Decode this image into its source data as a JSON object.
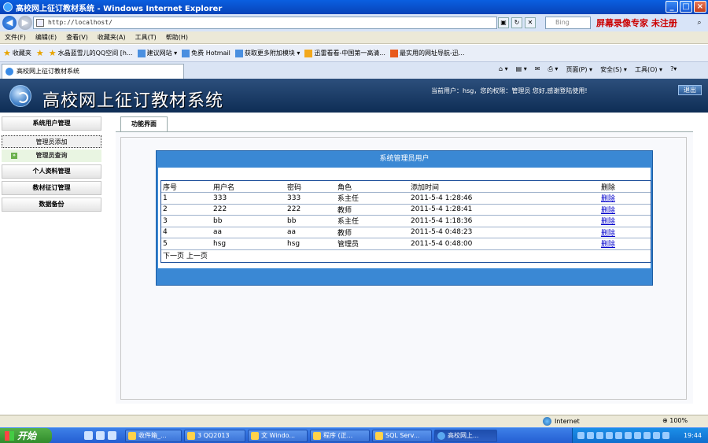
{
  "window": {
    "title": "高校网上征订教材系统 - Windows Internet Explorer",
    "url": "http://localhost/",
    "search_placeholder": "Bing",
    "recorder_text": "屏幕录像专家 未注册"
  },
  "menu": [
    "文件(F)",
    "编辑(E)",
    "查看(V)",
    "收藏夹(A)",
    "工具(T)",
    "帮助(H)"
  ],
  "favorites": {
    "label": "收藏夹",
    "items": [
      "水晶蓝雪儿的QQ空间 [h...",
      "建议网站 ▾",
      "免费 Hotmail",
      "获取更多附加模块 ▾",
      "迅雷看看-中国第一高清...",
      "最实用的网址导航-迅..."
    ]
  },
  "browser_tab": {
    "label": "高校网上征订教材系统",
    "tools": [
      "页面(P) ▾",
      "安全(S) ▾",
      "工具(O) ▾"
    ]
  },
  "app": {
    "title": "高校网上征订教材系统",
    "user_info": "当前用户：hsg，您的权限：管理员 您好,感谢登陆使用!",
    "logout_label": "退出"
  },
  "sidebar": {
    "groups": [
      {
        "label": "系统用户管理"
      },
      {
        "label": "个人资料管理"
      },
      {
        "label": "教材征订管理"
      },
      {
        "label": "数据备份"
      }
    ],
    "subitems": [
      {
        "label": "管理员添加"
      },
      {
        "label": "管理员查询"
      }
    ]
  },
  "content": {
    "tab_label": "功能界面",
    "panel_title": "系统管理员用户",
    "columns": [
      "序号",
      "用户名",
      "密码",
      "角色",
      "添加时间",
      "删除"
    ],
    "rows": [
      {
        "id": "1",
        "username": "333",
        "password": "333",
        "role": "系主任",
        "time": "2011-5-4 1:28:46",
        "action": "删除"
      },
      {
        "id": "2",
        "username": "222",
        "password": "222",
        "role": "教师",
        "time": "2011-5-4 1:28:41",
        "action": "删除"
      },
      {
        "id": "3",
        "username": "bb",
        "password": "bb",
        "role": "系主任",
        "time": "2011-5-4 1:18:36",
        "action": "删除"
      },
      {
        "id": "4",
        "username": "aa",
        "password": "aa",
        "role": "教师",
        "time": "2011-5-4 0:48:23",
        "action": "删除"
      },
      {
        "id": "5",
        "username": "hsg",
        "password": "hsg",
        "role": "管理员",
        "time": "2011-5-4 0:48:00",
        "action": "删除"
      }
    ],
    "pager": {
      "next": "下一页",
      "prev": "上一页"
    }
  },
  "statusbar": {
    "zone": "Internet",
    "zoom": "100%"
  },
  "taskbar": {
    "start_label": "开始",
    "buttons": [
      "收件箱_...",
      "3 QQ2013",
      "文 Windo...",
      "程序 (正...",
      "SQL Serv...",
      "高校网上..."
    ],
    "clock": "19:44"
  },
  "colors": {
    "header_bg": "#0e2d55",
    "panel_blue": "#3a88d4",
    "link_blue": "#0000cc"
  }
}
